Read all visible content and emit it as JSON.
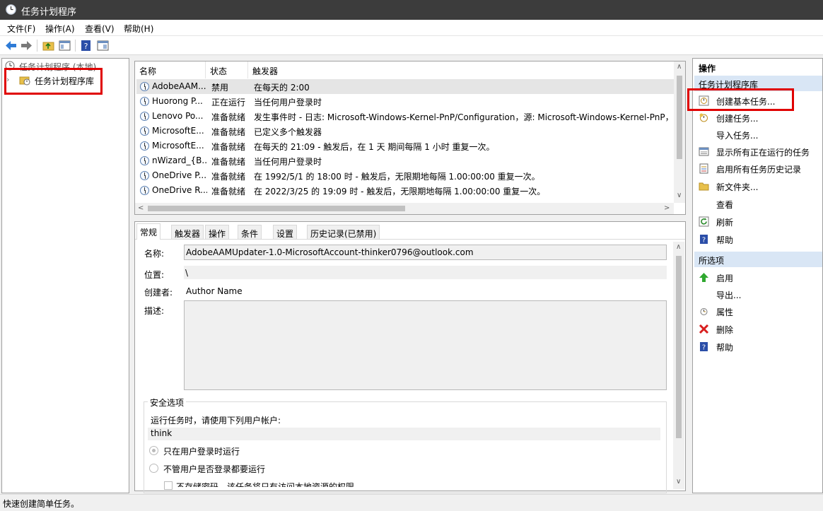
{
  "window": {
    "title": "任务计划程序"
  },
  "menu": [
    "文件(F)",
    "操作(A)",
    "查看(V)",
    "帮助(H)"
  ],
  "toolbar": {
    "icons": [
      "back-arrow-icon",
      "forward-arrow-icon",
      "folder-up-icon",
      "console-tree-icon",
      "help-icon",
      "show-pane-icon"
    ]
  },
  "tree": {
    "root": "任务计划程序 (本地)",
    "library": "任务计划程序库"
  },
  "task_list": {
    "columns": [
      "名称",
      "状态",
      "触发器"
    ],
    "rows": [
      {
        "name": "AdobeAAM...",
        "status": "禁用",
        "trigger": "在每天的 2:00"
      },
      {
        "name": "Huorong P...",
        "status": "正在运行",
        "trigger": "当任何用户登录时"
      },
      {
        "name": "Lenovo Po...",
        "status": "准备就绪",
        "trigger": "发生事件时 - 日志: Microsoft-Windows-Kernel-PnP/Configuration，源: Microsoft-Windows-Kernel-PnP，"
      },
      {
        "name": "MicrosoftE...",
        "status": "准备就绪",
        "trigger": "已定义多个触发器"
      },
      {
        "name": "MicrosoftE...",
        "status": "准备就绪",
        "trigger": "在每天的 21:09 - 触发后，在 1 天 期间每隔 1 小时 重复一次。"
      },
      {
        "name": "nWizard_{B...",
        "status": "准备就绪",
        "trigger": "当任何用户登录时"
      },
      {
        "name": "OneDrive P...",
        "status": "准备就绪",
        "trigger": "在 1992/5/1 的 18:00 时 - 触发后，无限期地每隔 1.00:00:00 重复一次。"
      },
      {
        "name": "OneDrive R...",
        "status": "准备就绪",
        "trigger": "在 2022/3/25 的 19:09 时 - 触发后，无限期地每隔 1.00:00:00 重复一次。"
      }
    ]
  },
  "detail": {
    "tabs": [
      "常规",
      "触发器",
      "操作",
      "条件",
      "设置",
      "历史记录(已禁用)"
    ],
    "name_label": "名称:",
    "name_value": "AdobeAAMUpdater-1.0-MicrosoftAccount-thinker0796@outlook.com",
    "location_label": "位置:",
    "location_value": "\\",
    "author_label": "创建者:",
    "author_value": "Author Name",
    "description_label": "描述:",
    "description_value": "",
    "security_title": "安全选项",
    "run_as_label": "运行任务时，请使用下列用户帐户:",
    "run_as_user": "think",
    "radio_logged_on": "只在用户登录时运行",
    "radio_any": "不管用户是否登录都要运行",
    "no_password": "不存储密码。该任务将只有访问本地资源的权限"
  },
  "actions": {
    "header": "操作",
    "section1": "任务计划程序库",
    "items1": [
      {
        "label": "创建基本任务...",
        "icon": "create-basic-task-icon"
      },
      {
        "label": "创建任务...",
        "icon": "create-task-icon"
      },
      {
        "label": "导入任务...",
        "icon": ""
      },
      {
        "label": "显示所有正在运行的任务",
        "icon": "running-tasks-icon"
      },
      {
        "label": "启用所有任务历史记录",
        "icon": "history-icon"
      },
      {
        "label": "新文件夹...",
        "icon": "folder-icon"
      },
      {
        "label": "查看",
        "icon": ""
      },
      {
        "label": "刷新",
        "icon": "refresh-icon"
      },
      {
        "label": "帮助",
        "icon": "help-icon"
      }
    ],
    "section2": "所选项",
    "items2": [
      {
        "label": "启用",
        "icon": "enable-arrow-icon"
      },
      {
        "label": "导出...",
        "icon": ""
      },
      {
        "label": "属性",
        "icon": "properties-clock-icon"
      },
      {
        "label": "删除",
        "icon": "delete-x-icon"
      },
      {
        "label": "帮助",
        "icon": "help-icon"
      }
    ]
  },
  "status": "快速创建简单任务。",
  "colors": {
    "highlight": "#e00000",
    "selected_row": "#e5e5e5",
    "section_bg": "#d9e6f5",
    "titlebar": "#3c3c3c"
  }
}
